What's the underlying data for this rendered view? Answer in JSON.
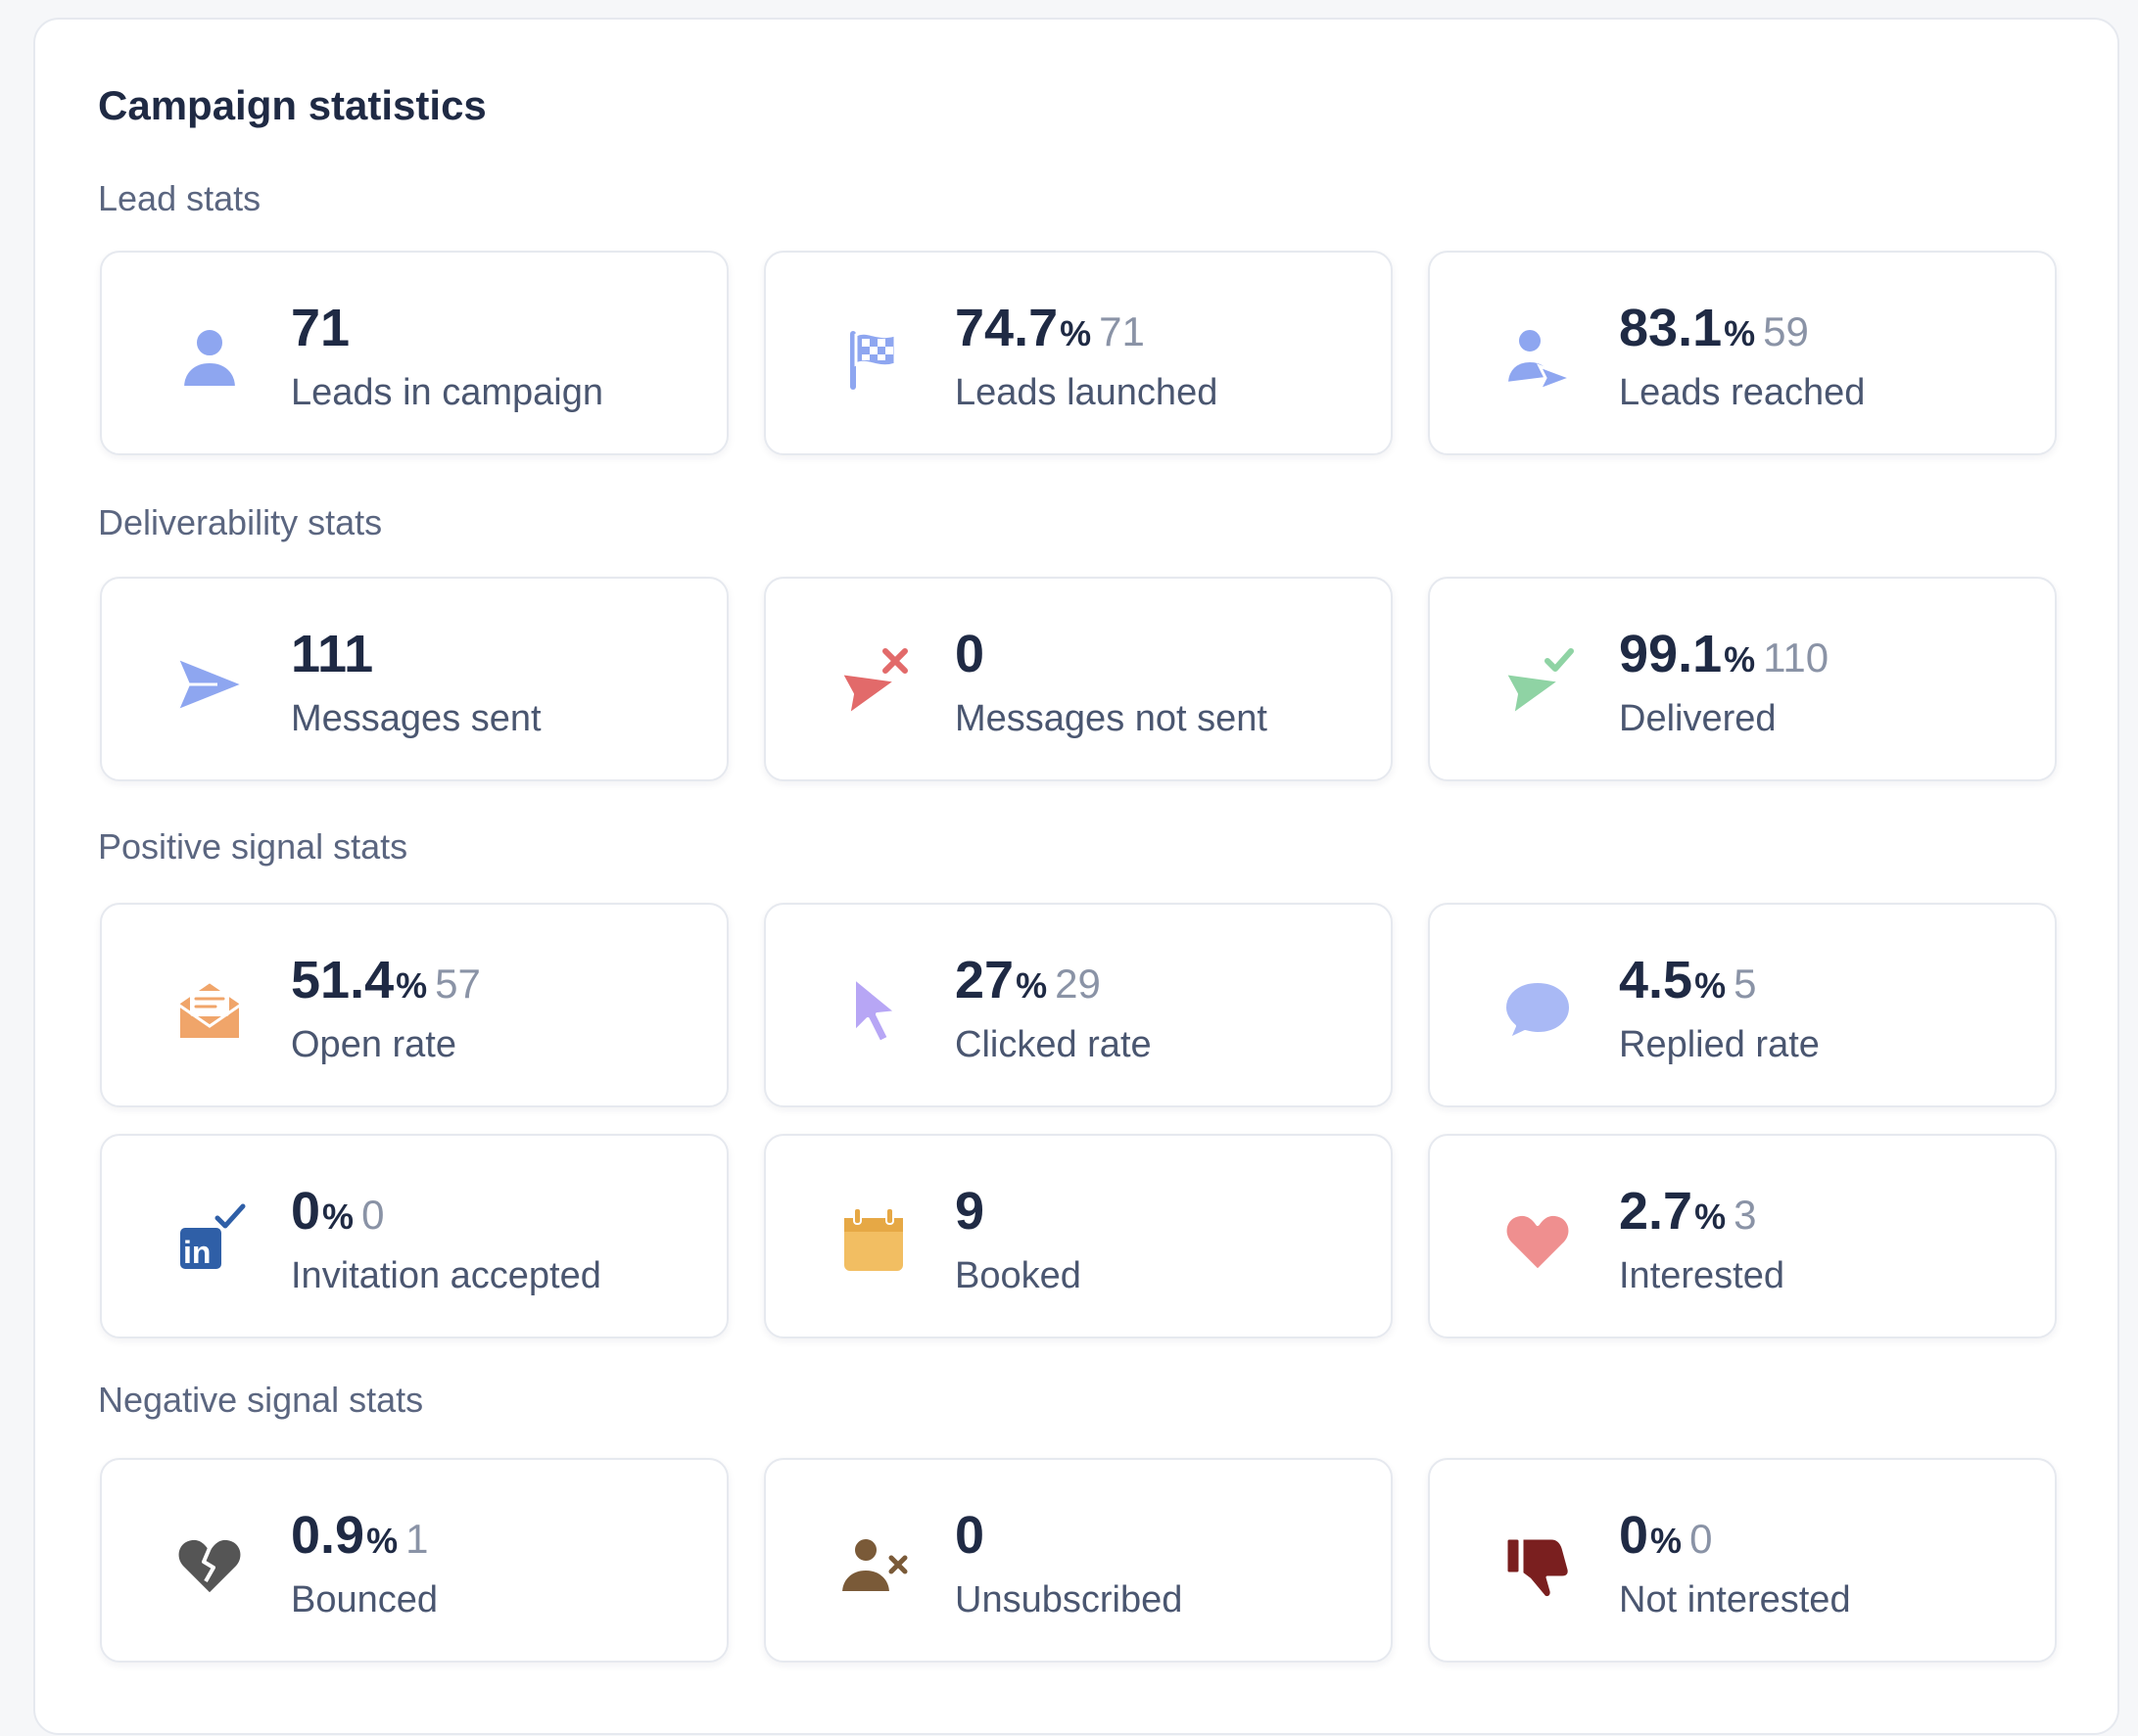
{
  "title": "Campaign statistics",
  "sections": [
    {
      "label": "Lead stats",
      "cards": [
        {
          "value": "71",
          "label": "Leads in campaign",
          "icon": "person-icon"
        },
        {
          "value": "74.7",
          "pct": "%",
          "count": "71",
          "label": "Leads launched",
          "icon": "checkered-flag-icon"
        },
        {
          "value": "83.1",
          "pct": "%",
          "count": "59",
          "label": "Leads reached",
          "icon": "person-send-icon"
        }
      ]
    },
    {
      "label": "Deliverability stats",
      "cards": [
        {
          "value": "111",
          "label": "Messages sent",
          "icon": "paper-plane-icon"
        },
        {
          "value": "0",
          "label": "Messages not sent",
          "icon": "paper-plane-failed-icon"
        },
        {
          "value": "99.1",
          "pct": "%",
          "count": "110",
          "label": "Delivered",
          "icon": "paper-plane-check-icon"
        }
      ]
    },
    {
      "label": "Positive signal stats",
      "cards": [
        {
          "value": "51.4",
          "pct": "%",
          "count": "57",
          "label": "Open rate",
          "icon": "open-envelope-icon"
        },
        {
          "value": "27",
          "pct": "%",
          "count": "29",
          "label": "Clicked rate",
          "icon": "cursor-icon"
        },
        {
          "value": "4.5",
          "pct": "%",
          "count": "5",
          "label": "Replied rate",
          "icon": "speech-bubble-icon"
        },
        {
          "value": "0",
          "pct": "%",
          "count": "0",
          "label": "Invitation accepted",
          "icon": "linkedin-check-icon"
        },
        {
          "value": "9",
          "label": "Booked",
          "icon": "calendar-icon"
        },
        {
          "value": "2.7",
          "pct": "%",
          "count": "3",
          "label": "Interested",
          "icon": "heart-icon"
        }
      ]
    },
    {
      "label": "Negative signal stats",
      "cards": [
        {
          "value": "0.9",
          "pct": "%",
          "count": "1",
          "label": "Bounced",
          "icon": "broken-heart-icon"
        },
        {
          "value": "0",
          "label": "Unsubscribed",
          "icon": "person-remove-icon"
        },
        {
          "value": "0",
          "pct": "%",
          "count": "0",
          "label": "Not interested",
          "icon": "thumbs-down-icon"
        }
      ]
    }
  ],
  "colors": {
    "text": "#1f2a44",
    "muted": "#8a93a6",
    "label": "#5b6680",
    "blue_icon": "#8ea6f0",
    "red_icon": "#e26a6a",
    "green_icon": "#8fd3a4",
    "orange_icon": "#f0a56a",
    "purple_icon": "#b7a6f5",
    "yellow_icon": "#f2be62",
    "pink_icon": "#ef8f8f",
    "linkedin": "#2f5fa7",
    "broken_heart": "#555555",
    "unsubscribe": "#7a5a38",
    "thumbs_down": "#7a1f1f"
  }
}
